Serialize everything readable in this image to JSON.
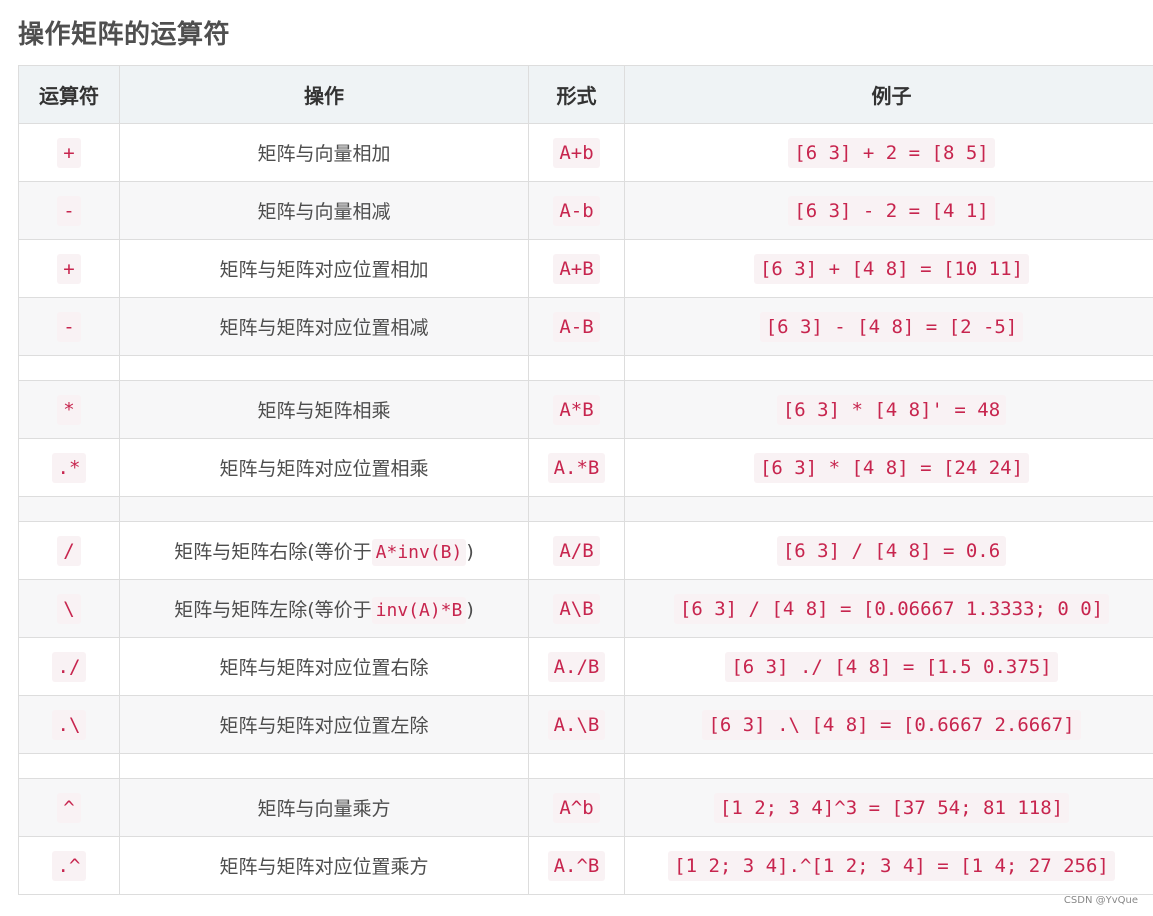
{
  "title": "操作矩阵的运算符",
  "headers": {
    "operator": "运算符",
    "operation": "操作",
    "form": "形式",
    "example": "例子"
  },
  "rows": {
    "0": {
      "op": "+",
      "desc": "矩阵与向量相加",
      "form": "A+b",
      "example": "[6 3] + 2 = [8 5]"
    },
    "1": {
      "op": "-",
      "desc": "矩阵与向量相减",
      "form": "A-b",
      "example": "[6 3] - 2 = [4 1]"
    },
    "2": {
      "op": "+",
      "desc": "矩阵与矩阵对应位置相加",
      "form": "A+B",
      "example": "[6 3] + [4 8] = [10 11]"
    },
    "3": {
      "op": "-",
      "desc": "矩阵与矩阵对应位置相减",
      "form": "A-B",
      "example": "[6 3] - [4 8] = [2 -5]"
    },
    "4": {
      "op": "*",
      "desc": "矩阵与矩阵相乘",
      "form": "A*B",
      "example": "[6 3] * [4 8]' = 48"
    },
    "5": {
      "op": ".*",
      "desc": "矩阵与矩阵对应位置相乘",
      "form": "A.*B",
      "example": "[6 3] * [4 8] = [24 24]"
    },
    "6": {
      "op": "/",
      "desc_pre": "矩阵与矩阵右除(等价于",
      "desc_code": "A*inv(B)",
      "desc_post": ")",
      "form": "A/B",
      "example": "[6 3] / [4 8] = 0.6"
    },
    "7": {
      "op": "\\",
      "desc_pre": "矩阵与矩阵左除(等价于",
      "desc_code": "inv(A)*B",
      "desc_post": ")",
      "form": "A\\B",
      "example": "[6 3] / [4 8] = [0.06667 1.3333; 0 0]"
    },
    "8": {
      "op": "./",
      "desc": "矩阵与矩阵对应位置右除",
      "form": "A./B",
      "example": "[6 3] ./ [4 8] = [1.5 0.375]"
    },
    "9": {
      "op": ".\\",
      "desc": "矩阵与矩阵对应位置左除",
      "form": "A.\\B",
      "example": "[6 3] .\\ [4 8] = [0.6667 2.6667]"
    },
    "10": {
      "op": "^",
      "desc": "矩阵与向量乘方",
      "form": "A^b",
      "example": "[1 2; 3 4]^3 = [37 54; 81 118]"
    },
    "11": {
      "op": ".^",
      "desc": "矩阵与矩阵对应位置乘方",
      "form": "A.^B",
      "example": "[1 2; 3 4].^[1 2; 3 4] = [1 4; 27 256]"
    }
  },
  "watermark": "CSDN @YvQue"
}
